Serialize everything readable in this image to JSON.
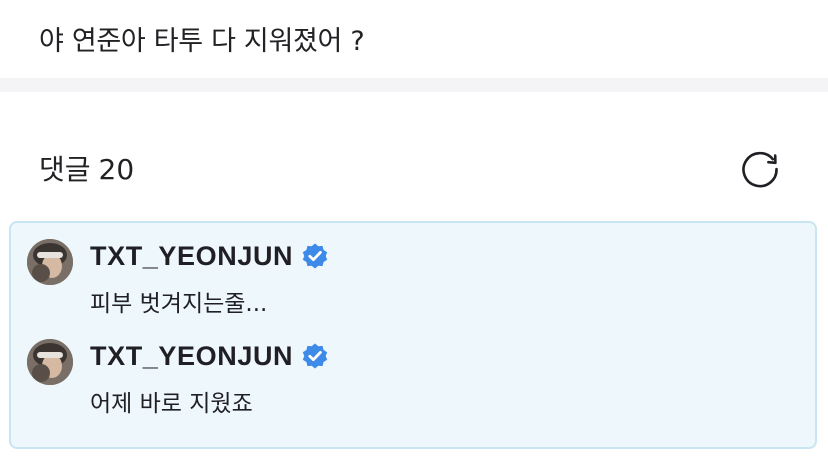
{
  "post": {
    "text": "야 연준아 타투 다 지워졌어 ?"
  },
  "comments_section": {
    "label": "댓글",
    "count": "20",
    "refresh_icon": "refresh-icon"
  },
  "colors": {
    "comment_box_bg": "#eef7fc",
    "comment_box_border": "#c9e4f2",
    "verified_badge": "#3d8ae8"
  },
  "comments": [
    {
      "author": "TXT_YEONJUN",
      "verified_icon": "verified-badge-icon",
      "text": "피부 벗겨지는줄..."
    },
    {
      "author": "TXT_YEONJUN",
      "verified_icon": "verified-badge-icon",
      "text": "어제 바로 지웠죠"
    }
  ]
}
